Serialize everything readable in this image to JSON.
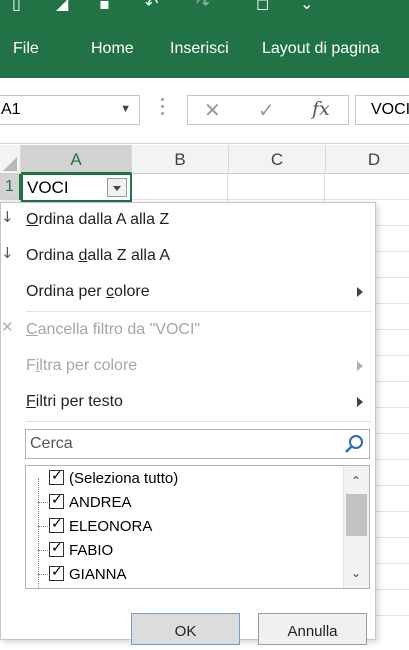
{
  "ribbon": {
    "tabs": [
      "File",
      "Home",
      "Inserisci",
      "Layout di pagina"
    ]
  },
  "formula_bar": {
    "name_box": "A1",
    "fx_label": "fx",
    "value": "VOCI"
  },
  "grid": {
    "columns": [
      "A",
      "B",
      "C",
      "D"
    ],
    "rows": [
      "1"
    ],
    "cell_a1": "VOCI"
  },
  "filter_menu": {
    "sort_az": {
      "pre": "",
      "ul": "O",
      "post": "rdina dalla A alla Z"
    },
    "sort_za": {
      "pre": "Ordina ",
      "ul": "d",
      "post": "alla Z alla A"
    },
    "sort_color": {
      "pre": "Ordina per ",
      "ul": "c",
      "post": "olore"
    },
    "clear_filter": {
      "pre": "",
      "ul": "C",
      "post": "ancella filtro da \"VOCI\""
    },
    "filter_color": {
      "pre": "F",
      "ul": "i",
      "post": "ltra per colore"
    },
    "text_filters": {
      "pre": "",
      "ul": "F",
      "post": "iltri per testo"
    },
    "search_placeholder": "Cerca",
    "items": [
      "(Seleziona tutto)",
      "ANDREA",
      "ELEONORA",
      "FABIO",
      "GIANNA"
    ],
    "ok_label": "OK",
    "cancel_label": "Annulla"
  },
  "colors": {
    "accent": "#217346",
    "disabled": "#a6a6a6"
  }
}
